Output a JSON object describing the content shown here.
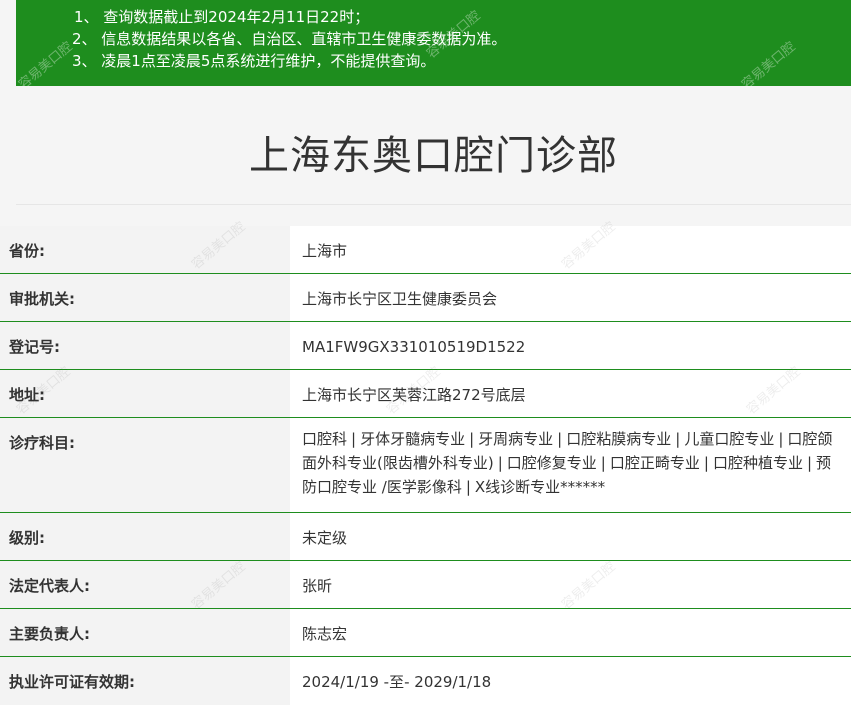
{
  "notice": {
    "lines": [
      "1、 查询数据截止到2024年2月11日22时；",
      "2、 信息数据结果以各省、自治区、直辖市卫生健康委数据为准。",
      "3、 凌晨1点至凌晨5点系统进行维护，不能提供查询。"
    ],
    "watermark": "容易美口腔"
  },
  "page_title": "上海东奥口腔门诊部",
  "info": {
    "province_label": "省份:",
    "province_value": "上海市",
    "authority_label": "审批机关:",
    "authority_value": "上海市长宁区卫生健康委员会",
    "reg_label": "登记号:",
    "reg_value": "MA1FW9GX331010519D1522",
    "address_label": "地址:",
    "address_value": "上海市长宁区芙蓉江路272号底层",
    "subjects_label": "诊疗科目:",
    "subjects": [
      "口腔科",
      "牙体牙髓病专业",
      "牙周病专业",
      "口腔粘膜病专业",
      "儿童口腔专业",
      "口腔颌面外科专业(限齿槽外科专业)",
      "口腔修复专业",
      "口腔正畸专业",
      "口腔种植专业",
      "预防口腔专业 /医学影像科",
      "X线诊断专业******"
    ],
    "separator": "|",
    "level_label": "级别:",
    "level_value": "未定级",
    "legal_label": "法定代表人:",
    "legal_value": "张昕",
    "principal_label": "主要负责人:",
    "principal_value": "陈志宏",
    "license_label": "执业许可证有效期:",
    "license_value": "2024/1/19 -至- 2029/1/18"
  }
}
